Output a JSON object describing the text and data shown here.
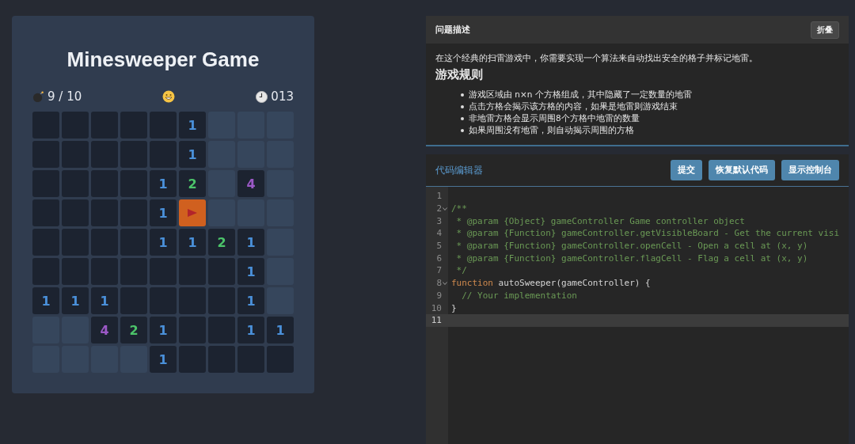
{
  "game": {
    "title": "Minesweeper Game",
    "mines": "9 / 10",
    "timer": "013",
    "board": [
      [
        {
          "kind": "open"
        },
        {
          "kind": "open"
        },
        {
          "kind": "open"
        },
        {
          "kind": "open"
        },
        {
          "kind": "open"
        },
        {
          "kind": "open",
          "text": "1",
          "color": "#4a90d9"
        },
        {
          "kind": "hidden"
        },
        {
          "kind": "hidden"
        },
        {
          "kind": "hidden"
        }
      ],
      [
        {
          "kind": "open"
        },
        {
          "kind": "open"
        },
        {
          "kind": "open"
        },
        {
          "kind": "open"
        },
        {
          "kind": "open"
        },
        {
          "kind": "open",
          "text": "1",
          "color": "#4a90d9"
        },
        {
          "kind": "hidden"
        },
        {
          "kind": "hidden"
        },
        {
          "kind": "hidden"
        }
      ],
      [
        {
          "kind": "open"
        },
        {
          "kind": "open"
        },
        {
          "kind": "open"
        },
        {
          "kind": "open"
        },
        {
          "kind": "open",
          "text": "1",
          "color": "#4a90d9"
        },
        {
          "kind": "open",
          "text": "2",
          "color": "#4cc46a"
        },
        {
          "kind": "hidden"
        },
        {
          "kind": "open",
          "text": "4",
          "color": "#9b59c6"
        },
        {
          "kind": "hidden"
        }
      ],
      [
        {
          "kind": "open"
        },
        {
          "kind": "open"
        },
        {
          "kind": "open"
        },
        {
          "kind": "open"
        },
        {
          "kind": "open",
          "text": "1",
          "color": "#4a90d9"
        },
        {
          "kind": "flag"
        },
        {
          "kind": "hidden"
        },
        {
          "kind": "hidden"
        },
        {
          "kind": "hidden"
        }
      ],
      [
        {
          "kind": "open"
        },
        {
          "kind": "open"
        },
        {
          "kind": "open"
        },
        {
          "kind": "open"
        },
        {
          "kind": "open",
          "text": "1",
          "color": "#4a90d9"
        },
        {
          "kind": "open",
          "text": "1",
          "color": "#4a90d9"
        },
        {
          "kind": "open",
          "text": "2",
          "color": "#4cc46a"
        },
        {
          "kind": "open",
          "text": "1",
          "color": "#4a90d9"
        },
        {
          "kind": "hidden"
        }
      ],
      [
        {
          "kind": "open"
        },
        {
          "kind": "open"
        },
        {
          "kind": "open"
        },
        {
          "kind": "open"
        },
        {
          "kind": "open"
        },
        {
          "kind": "open"
        },
        {
          "kind": "open"
        },
        {
          "kind": "open",
          "text": "1",
          "color": "#4a90d9"
        },
        {
          "kind": "hidden"
        }
      ],
      [
        {
          "kind": "open",
          "text": "1",
          "color": "#4a90d9"
        },
        {
          "kind": "open",
          "text": "1",
          "color": "#4a90d9"
        },
        {
          "kind": "open",
          "text": "1",
          "color": "#4a90d9"
        },
        {
          "kind": "open"
        },
        {
          "kind": "open"
        },
        {
          "kind": "open"
        },
        {
          "kind": "open"
        },
        {
          "kind": "open",
          "text": "1",
          "color": "#4a90d9"
        },
        {
          "kind": "hidden"
        }
      ],
      [
        {
          "kind": "hidden"
        },
        {
          "kind": "hidden"
        },
        {
          "kind": "open",
          "text": "4",
          "color": "#9b59c6"
        },
        {
          "kind": "open",
          "text": "2",
          "color": "#4cc46a"
        },
        {
          "kind": "open",
          "text": "1",
          "color": "#4a90d9"
        },
        {
          "kind": "open"
        },
        {
          "kind": "open"
        },
        {
          "kind": "open",
          "text": "1",
          "color": "#4a90d9"
        },
        {
          "kind": "open",
          "text": "1",
          "color": "#4a90d9"
        }
      ],
      [
        {
          "kind": "hidden"
        },
        {
          "kind": "hidden"
        },
        {
          "kind": "hidden"
        },
        {
          "kind": "hidden"
        },
        {
          "kind": "open",
          "text": "1",
          "color": "#4a90d9"
        },
        {
          "kind": "open"
        },
        {
          "kind": "open"
        },
        {
          "kind": "open"
        },
        {
          "kind": "open"
        }
      ]
    ]
  },
  "description": {
    "title": "问题描述",
    "collapse_button": "折叠",
    "intro": "在这个经典的扫雷游戏中，你需要实现一个算法来自动找出安全的格子并标记地雷。",
    "heading": "游戏规则",
    "rules": [
      "游戏区域由 n×n 个方格组成，其中隐藏了一定数量的地雷",
      "点击方格会揭示该方格的内容，如果是地雷则游戏结束",
      "非地雷方格会显示周围8个方格中地雷的数量",
      "如果周围没有地雷，则自动揭示周围的方格"
    ]
  },
  "editor": {
    "title": "代码编辑器",
    "buttons": [
      "提交",
      "恢复默认代码",
      "显示控制台"
    ],
    "lines": [
      {
        "number": "1",
        "fold": false,
        "current": false
      },
      {
        "number": "2",
        "fold": true,
        "current": false,
        "tokens": [
          {
            "kind": "comment",
            "text": "/**"
          }
        ]
      },
      {
        "number": "3",
        "fold": false,
        "current": false,
        "tokens": [
          {
            "kind": "comment",
            "text": " * @param {Object} gameController Game controller object"
          }
        ]
      },
      {
        "number": "4",
        "fold": false,
        "current": false,
        "tokens": [
          {
            "kind": "comment",
            "text": " * @param {Function} gameController.getVisibleBoard - Get the current visi"
          }
        ]
      },
      {
        "number": "5",
        "fold": false,
        "current": false,
        "tokens": [
          {
            "kind": "comment",
            "text": " * @param {Function} gameController.openCell - Open a cell at (x, y)"
          }
        ]
      },
      {
        "number": "6",
        "fold": false,
        "current": false,
        "tokens": [
          {
            "kind": "comment",
            "text": " * @param {Function} gameController.flagCell - Flag a cell at (x, y)"
          }
        ]
      },
      {
        "number": "7",
        "fold": false,
        "current": false,
        "tokens": [
          {
            "kind": "comment",
            "text": " */"
          }
        ]
      },
      {
        "number": "8",
        "fold": true,
        "current": false,
        "tokens": [
          {
            "kind": "keyword",
            "text": "function"
          },
          {
            "kind": "plain",
            "text": " autoSweeper(gameController) {"
          }
        ]
      },
      {
        "number": "9",
        "fold": false,
        "current": false,
        "tokens": [
          {
            "kind": "comment",
            "text": "  // Your implementation"
          }
        ]
      },
      {
        "number": "10",
        "fold": false,
        "current": false,
        "tokens": [
          {
            "kind": "plain",
            "text": "}"
          }
        ]
      },
      {
        "number": "11",
        "fold": false,
        "current": true
      }
    ]
  }
}
